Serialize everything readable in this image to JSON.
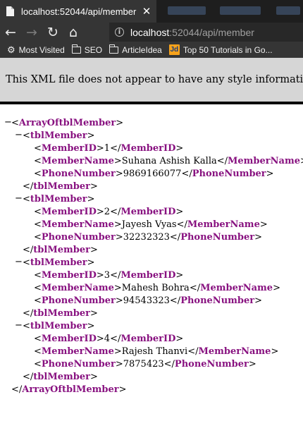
{
  "tab": {
    "title": "localhost:52044/api/member",
    "close": "✕"
  },
  "nav": {
    "back": "←",
    "forward": "→",
    "reload": "↻",
    "home": "⌂"
  },
  "url": {
    "host": "localhost",
    "path": ":52044/api/member",
    "info_icon": "i"
  },
  "bookmarks": [
    {
      "label": "Most Visited",
      "icon": "gear-icon"
    },
    {
      "label": "SEO",
      "icon": "folder-icon"
    },
    {
      "label": "ArticleIdea",
      "icon": "folder-icon"
    },
    {
      "label": "Top 50 Tutorials in Go...",
      "icon": "jd-logo",
      "logo_text": "Jd"
    }
  ],
  "xml_notice": "This XML file does not appear to have any style information associated with it. The document tree is shown below.",
  "xml": {
    "root_tag": "ArrayOftblMember",
    "item_tag": "tblMember",
    "fields": [
      "MemberID",
      "MemberName",
      "PhoneNumber"
    ],
    "members": [
      {
        "MemberID": "1",
        "MemberName": "Suhana Ashish Kalla",
        "PhoneNumber": "9869166077"
      },
      {
        "MemberID": "2",
        "MemberName": "Jayesh Vyas",
        "PhoneNumber": "32232323"
      },
      {
        "MemberID": "3",
        "MemberName": "Mahesh Bohra",
        "PhoneNumber": "94543323"
      },
      {
        "MemberID": "4",
        "MemberName": "Rajesh Thanvi",
        "PhoneNumber": "7875423"
      }
    ],
    "collapser": "−"
  },
  "colors": {
    "tag": "#881280",
    "chrome_dark": "#353535",
    "notice_bg": "#d6d6d6"
  }
}
